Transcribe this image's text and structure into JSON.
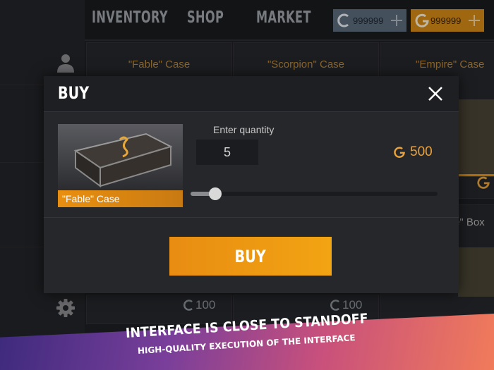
{
  "nav": {
    "tabs": [
      {
        "label": "INVENTORY"
      },
      {
        "label": "SHOP"
      },
      {
        "label": "MARKET"
      }
    ],
    "silver_balance": "999999",
    "gold_balance": "999999"
  },
  "background": {
    "cards": [
      {
        "title": "\"Fable\" Case"
      },
      {
        "title": "\"Scorpion\" Case"
      },
      {
        "title": "\"Empire\" Case"
      }
    ],
    "box_label": "e\" Box",
    "prices": [
      "100",
      "100"
    ]
  },
  "modal": {
    "title": "BUY",
    "item_name": "\"Fable\" Case",
    "quantity_label": "Enter quantity",
    "quantity_value": "5",
    "total_cost": "500",
    "slider_level": 0.1,
    "buy_label": "BUY"
  },
  "banner": {
    "line1": "INTERFACE IS CLOSE TO STANDOFF",
    "line2": "HIGH-QUALITY EXECUTION OF THE INTERFACE"
  },
  "colors": {
    "accent_orange": "#e98f10",
    "silver": "#5b6c7d",
    "gold": "#d48a16"
  }
}
